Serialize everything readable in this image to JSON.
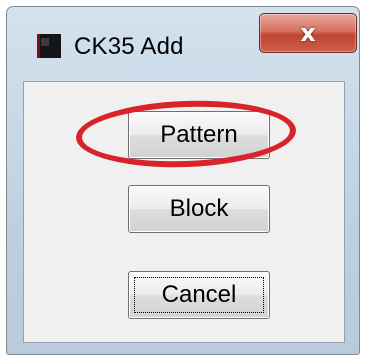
{
  "window": {
    "title": "CK35 Add",
    "close_glyph": "x",
    "icon": "app-icon"
  },
  "buttons": {
    "pattern_label": "Pattern",
    "block_label": "Block",
    "cancel_label": "Cancel"
  },
  "colors": {
    "annotation_ellipse": "#d9232b",
    "close_button": "#c24433",
    "client_background": "#f0f0f0"
  }
}
